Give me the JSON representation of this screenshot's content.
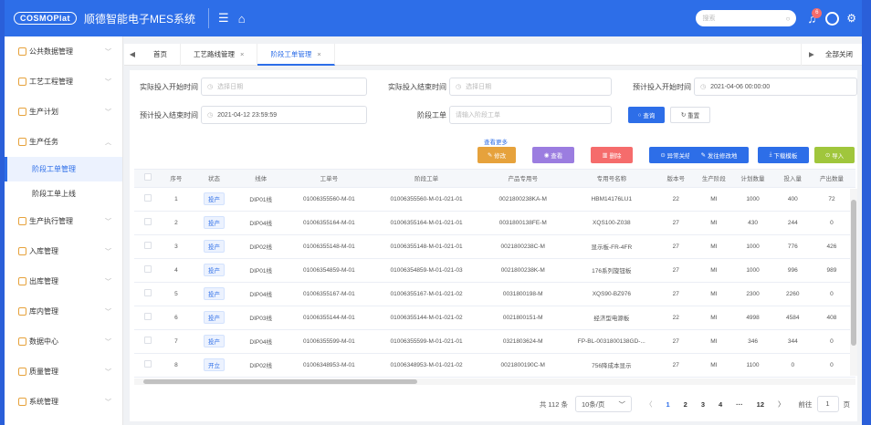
{
  "app": {
    "logo": "COSMOPlat",
    "title": "顺德智能电子MES系统"
  },
  "topbar": {
    "search_placeholder": "搜索",
    "notification_count": "6"
  },
  "sidebar": {
    "items": [
      {
        "label": "公共数据管理"
      },
      {
        "label": "工艺工程管理"
      },
      {
        "label": "生产计划"
      },
      {
        "label": "生产任务"
      },
      {
        "label": "生产执行管理"
      },
      {
        "label": "入库管理"
      },
      {
        "label": "出库管理"
      },
      {
        "label": "库内管理"
      },
      {
        "label": "数据中心"
      },
      {
        "label": "质量管理"
      },
      {
        "label": "系统管理"
      }
    ],
    "sub_items": [
      {
        "label": "阶段工单管理"
      },
      {
        "label": "阶段工单上线"
      }
    ]
  },
  "tabs": {
    "items": [
      {
        "label": "首页"
      },
      {
        "label": "工艺路线管理"
      },
      {
        "label": "阶段工单管理"
      }
    ],
    "close_all": "全部关闭"
  },
  "filters": {
    "actual_start_label": "实际投入开始时间",
    "actual_start_placeholder": "选择日期",
    "actual_end_label": "实际投入结束时间",
    "actual_end_placeholder": "选择日期",
    "planned_start_label": "预计投入开始时间",
    "planned_start_value": "2021-04-06 00:00:00",
    "planned_end_label": "预计投入结束时间",
    "planned_end_value": "2021-04-12 23:59:59",
    "stage_order_label": "阶段工单",
    "stage_order_placeholder": "请输入阶段工单",
    "query_label": "查询",
    "reset_label": "重置"
  },
  "toolbar": {
    "more": "查看更多",
    "edit": "修改",
    "view": "查看",
    "delete": "删除",
    "abnormal": "异常关结",
    "change": "发往修改地",
    "download": "下载模板",
    "import": "导入"
  },
  "table": {
    "headers": [
      "序号",
      "状态",
      "线体",
      "工单号",
      "阶段工单",
      "产品专用号",
      "专用号名称",
      "版本号",
      "生产阶段",
      "计划数量",
      "投入量",
      "产出数量"
    ],
    "rows": [
      [
        "1",
        "投产",
        "DIP01线",
        "01006355560-M-01",
        "01006355560-M-01-021-01",
        "0021800238KA-M",
        "HBM14176LU1",
        "22",
        "MI",
        "1000",
        "400",
        "72"
      ],
      [
        "2",
        "投产",
        "DIP04线",
        "01006355164-M-01",
        "01006355164-M-01-021-01",
        "0031800138FE-M",
        "XQS100-Z038",
        "27",
        "MI",
        "430",
        "244",
        "0"
      ],
      [
        "3",
        "投产",
        "DIP02线",
        "01006355148-M-01",
        "01006355148-M-01-021-01",
        "0021800238C-M",
        "显示板-FR-4FR",
        "27",
        "MI",
        "1000",
        "776",
        "426"
      ],
      [
        "4",
        "投产",
        "DIP01线",
        "01006354859-M-01",
        "01006354859-M-01-021-03",
        "0021800238K-M",
        "176系列旋钮板",
        "27",
        "MI",
        "1000",
        "996",
        "989"
      ],
      [
        "5",
        "投产",
        "DIP04线",
        "01006355167-M-01",
        "01006355167-M-01-021-02",
        "0031800198-M",
        "XQS90-BZ976",
        "27",
        "MI",
        "2300",
        "2260",
        "0"
      ],
      [
        "6",
        "投产",
        "DIP03线",
        "01006355144-M-01",
        "01006355144-M-01-021-02",
        "0021800151-M",
        "经济型电源板",
        "22",
        "MI",
        "4998",
        "4584",
        "408"
      ],
      [
        "7",
        "投产",
        "DIP04线",
        "01006355599-M-01",
        "01006355599-M-01-021-01",
        "0321803624-M",
        "FP-BL-0031800138GD-...",
        "27",
        "MI",
        "346",
        "344",
        "0"
      ],
      [
        "8",
        "开立",
        "DIP02线",
        "01006348953-M-01",
        "01006348953-M-01-021-02",
        "0021800190C-M",
        "756降成本显示",
        "27",
        "MI",
        "1100",
        "0",
        "0"
      ]
    ]
  },
  "pagination": {
    "total": "共 112 条",
    "page_size": "10条/页",
    "pages": [
      "1",
      "2",
      "3",
      "4",
      "···",
      "12"
    ],
    "goto_label": "前往",
    "goto_value": "1",
    "page_suffix": "页"
  }
}
